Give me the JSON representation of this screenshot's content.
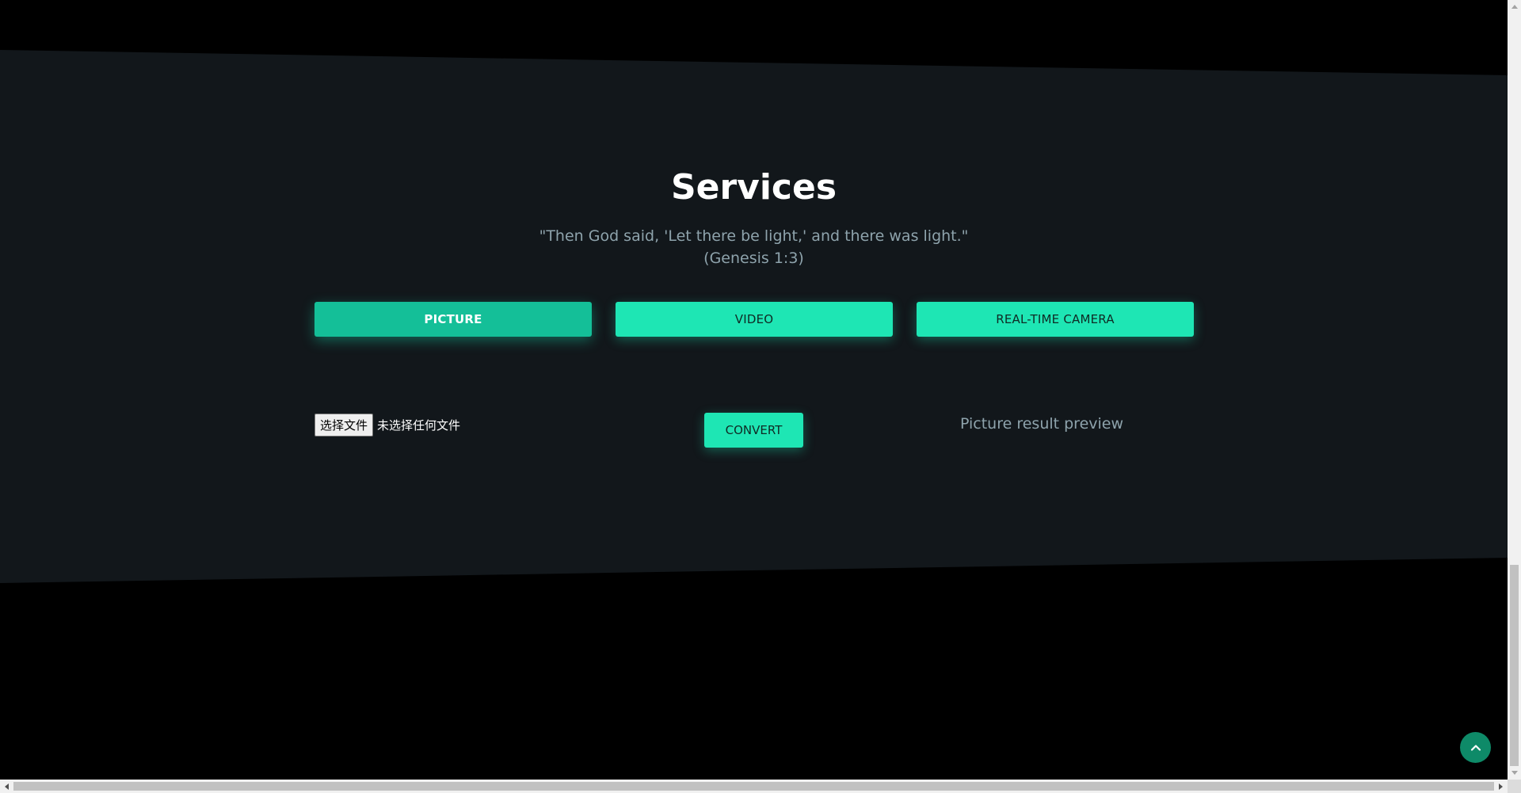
{
  "services": {
    "title": "Services",
    "quote_line1": "\"Then God said, 'Let there be light,' and there was light.\"",
    "quote_line2": "(Genesis 1:3)"
  },
  "tabs": [
    {
      "label": "PICTURE",
      "active": true
    },
    {
      "label": "VIDEO",
      "active": false
    },
    {
      "label": "REAL-TIME CAMERA",
      "active": false
    }
  ],
  "file_input": {
    "button_label": "选择文件",
    "status": "未选择任何文件"
  },
  "convert_label": "CONVERT",
  "preview_text": "Picture result preview",
  "back_to_top_icon": "chevron-up-icon",
  "colors": {
    "page_bg": "#000000",
    "section_bg": "#12171b",
    "accent": "#1ee6b4",
    "accent_active": "#14bf98",
    "muted_text": "#8ea3ac",
    "back_to_top": "#0e8a68"
  }
}
